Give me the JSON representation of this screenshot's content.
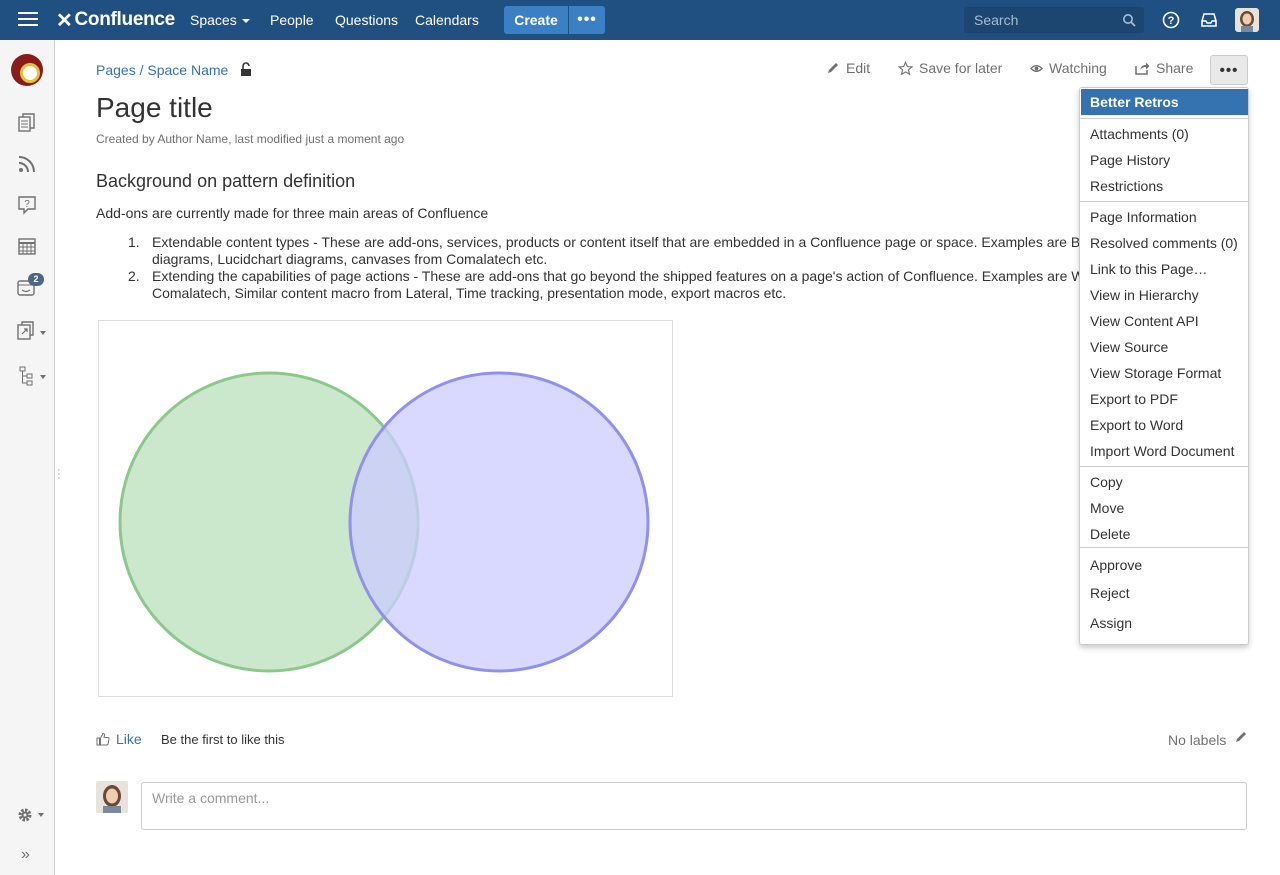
{
  "nav": {
    "brand": "Confluence",
    "spaces": "Spaces",
    "people": "People",
    "questions": "Questions",
    "calendars": "Calendars",
    "create": "Create",
    "more": "•••",
    "search_placeholder": "Search",
    "accent_color": "#205081"
  },
  "sidebar": {
    "notification_count": "2",
    "expand": "»"
  },
  "page": {
    "breadcrumb_pages": "Pages",
    "breadcrumb_sep": " / ",
    "breadcrumb_space": "Space Name",
    "title": "Page title",
    "byline": "Created by Author Name, last modified just a moment ago",
    "heading": "Background on pattern definition",
    "intro": "Add-ons are currently made for three main areas of Confluence",
    "list": [
      {
        "num": "1.",
        "text": "Extendable content types - These are add-ons, services, products or content itself that are embedded in a Confluence page or space. Examples are B",
        "text2": "diagrams, Lucidchart diagrams, canvases from Comalatech etc."
      },
      {
        "num": "2.",
        "text": "Extending the capabilities of page actions - These are add-ons that go beyond the shipped features on a page's action of Confluence. Examples are W",
        "text2": "Comalatech, Similar content macro from Lateral, Time tracking, presentation mode, export macros etc."
      }
    ]
  },
  "actions": {
    "edit": "Edit",
    "save_later": "Save for later",
    "watching": "Watching",
    "share": "Share",
    "more": "•••"
  },
  "menu": {
    "active": "Better Retros",
    "items": [
      "Attachments (0)",
      "Page History",
      "Restrictions",
      "Page Information",
      "Resolved comments (0)",
      "Link to this Page…",
      "View in Hierarchy",
      "View Content API",
      "View Source",
      "View Storage Format",
      "Export to PDF",
      "Export to Word",
      "Import Word Document",
      "Copy",
      "Move",
      "Delete",
      "Approve",
      "Reject",
      "Assign"
    ]
  },
  "venn": {
    "left_color": "#c8e6c9",
    "left_stroke": "#8bc98b",
    "right_color": "#ccccff",
    "right_stroke": "#9090f0"
  },
  "footer": {
    "like": "Like",
    "like_text": "Be the first to like this",
    "labels": "No labels",
    "comment_placeholder": "Write a comment..."
  }
}
